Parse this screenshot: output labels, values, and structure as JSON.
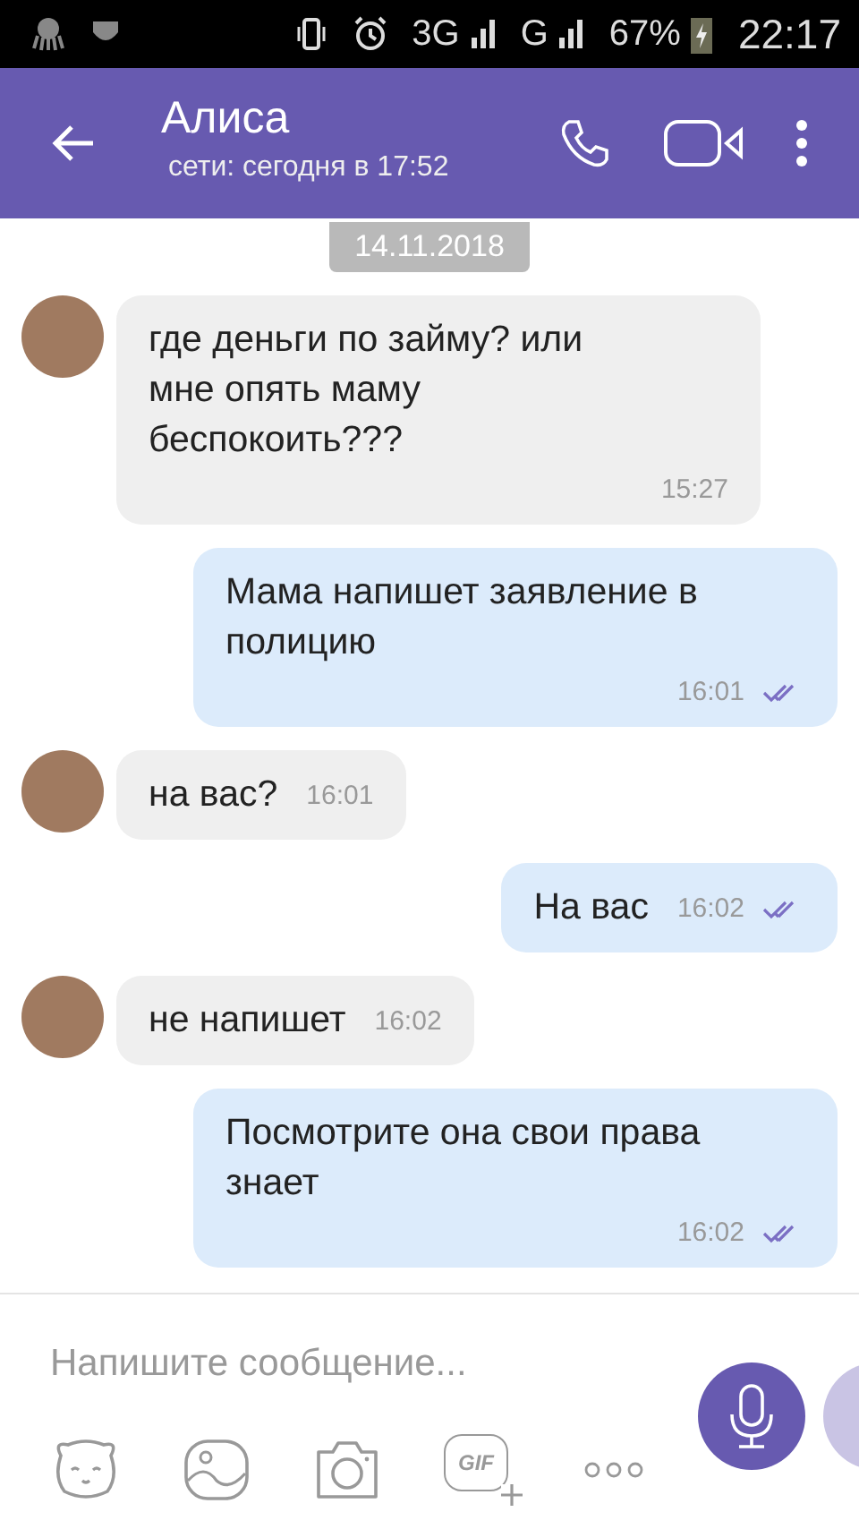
{
  "status_bar": {
    "network_1": "3G",
    "network_2": "G",
    "battery": "67%",
    "time": "22:17"
  },
  "header": {
    "title": "Алиса",
    "subtitle": "сети: сегодня в 17:52"
  },
  "date_chip": "14.11.2018",
  "messages": [
    {
      "kind": "incoming",
      "text": "где деньги по займу? или мне опять маму беспокоить???",
      "time": "15:27",
      "inline": false
    },
    {
      "kind": "outgoing",
      "text": "Мама напишет заявление в полицию",
      "time": "16:01",
      "inline": false,
      "read": true
    },
    {
      "kind": "incoming",
      "text": "на вас?",
      "time": "16:01",
      "inline": true
    },
    {
      "kind": "outgoing",
      "text": "На вас",
      "time": "16:02",
      "inline": true,
      "read": true
    },
    {
      "kind": "incoming",
      "text": "не напишет",
      "time": "16:02",
      "inline": true
    },
    {
      "kind": "outgoing",
      "text": "Посмотрите она свои права знает",
      "time": "16:02",
      "inline": false,
      "read": true
    }
  ],
  "composer": {
    "placeholder": "Напишите сообщение...",
    "gif_label": "GIF"
  }
}
